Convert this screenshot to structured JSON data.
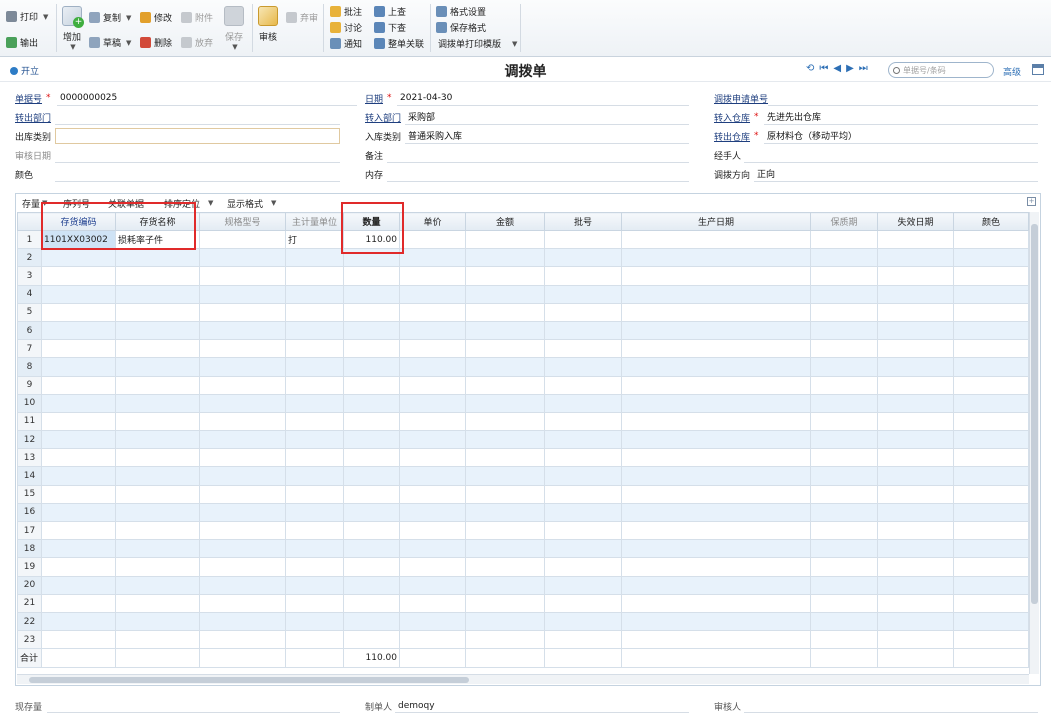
{
  "toolbar": {
    "print": "打印",
    "export": "输出",
    "add": "增加",
    "copy": "复制",
    "draft": "草稿",
    "modify": "修改",
    "delete": "删除",
    "attach": "附件",
    "abandon": "放弃",
    "save": "保存",
    "audit": "审核",
    "unaudit": "弃审",
    "annotate": "批注",
    "discuss": "讨论",
    "notify": "通知",
    "lookup_up": "上查",
    "lookup_down": "下查",
    "whole_link": "整单关联",
    "format_settings": "格式设置",
    "save_format": "保存格式",
    "print_template": "调拨单打印模版"
  },
  "titlebar": {
    "open": "开立",
    "title": "调拨单",
    "search_placeholder": "单据号/条码",
    "advanced": "高级"
  },
  "header": {
    "doc_no_label": "单据号",
    "doc_no": "0000000025",
    "date_label": "日期",
    "date": "2021-04-30",
    "request_no_label": "调拨申请单号",
    "request_no": "",
    "out_dept_label": "转出部门",
    "out_dept": "",
    "in_dept_label": "转入部门",
    "in_dept": "采购部",
    "in_wh_label": "转入仓库",
    "in_wh": "先进先出仓库",
    "out_type_label": "出库类别",
    "out_type": "",
    "in_type_label": "入库类别",
    "in_type": "普通采购入库",
    "out_wh_label": "转出仓库",
    "out_wh": "原材料仓（移动平均）",
    "audit_date_label": "审核日期",
    "audit_date": "",
    "remark_label": "备注",
    "remark": "",
    "handler_label": "经手人",
    "handler": "",
    "color_label": "颜色",
    "color": "",
    "memory_label": "内存",
    "memory": "",
    "direction_label": "调拨方向",
    "direction": "正向"
  },
  "grid_toolbar": {
    "stock": "存量",
    "serial": "序列号",
    "related": "关联单据",
    "sort": "排序定位",
    "display_format": "显示格式"
  },
  "grid": {
    "columns": [
      "存货编码",
      "存货名称",
      "规格型号",
      "主计量单位",
      "数量",
      "单价",
      "金额",
      "批号",
      "生产日期",
      "保质期",
      "失效日期",
      "颜色"
    ],
    "rows": [
      [
        "1101XX03002",
        "损耗率子件",
        "",
        "打",
        "110.00",
        "",
        "",
        "",
        "",
        "",
        "",
        ""
      ]
    ],
    "row_numbers": [
      "1",
      "2",
      "3",
      "4",
      "5",
      "6",
      "7",
      "8",
      "9",
      "10",
      "11",
      "12",
      "13",
      "14",
      "15",
      "16",
      "17",
      "18",
      "19",
      "20",
      "21",
      "22",
      "23"
    ],
    "total_label": "合计",
    "total_qty": "110.00"
  },
  "footer": {
    "stock_label": "现存量",
    "stock": "",
    "maker_label": "制单人",
    "maker": "demoqy",
    "auditor_label": "审核人",
    "auditor": ""
  },
  "colors": {
    "accent": "#2d6fb5",
    "highlight": "#e02a2a",
    "alt_row": "#e8f2fb"
  }
}
